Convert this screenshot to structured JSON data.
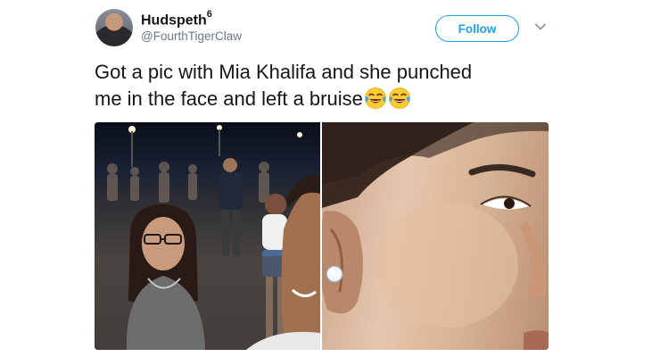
{
  "tweet": {
    "display_name": "Hudspeth",
    "name_superscript": "6",
    "handle": "@FourthTigerClaw",
    "follow_label": "Follow",
    "text_line1": "Got a pic with Mia Khalifa and she punched",
    "text_line2": "me in the face and left a bruise",
    "emojis": [
      "face-with-tears-of-joy-icon",
      "face-with-tears-of-joy-icon"
    ]
  },
  "colors": {
    "accent": "#1da1f2",
    "text": "#14171a",
    "muted": "#657786"
  },
  "media": {
    "photos": [
      {
        "name": "selfie-crowd-photo"
      },
      {
        "name": "face-closeup-photo"
      }
    ]
  }
}
